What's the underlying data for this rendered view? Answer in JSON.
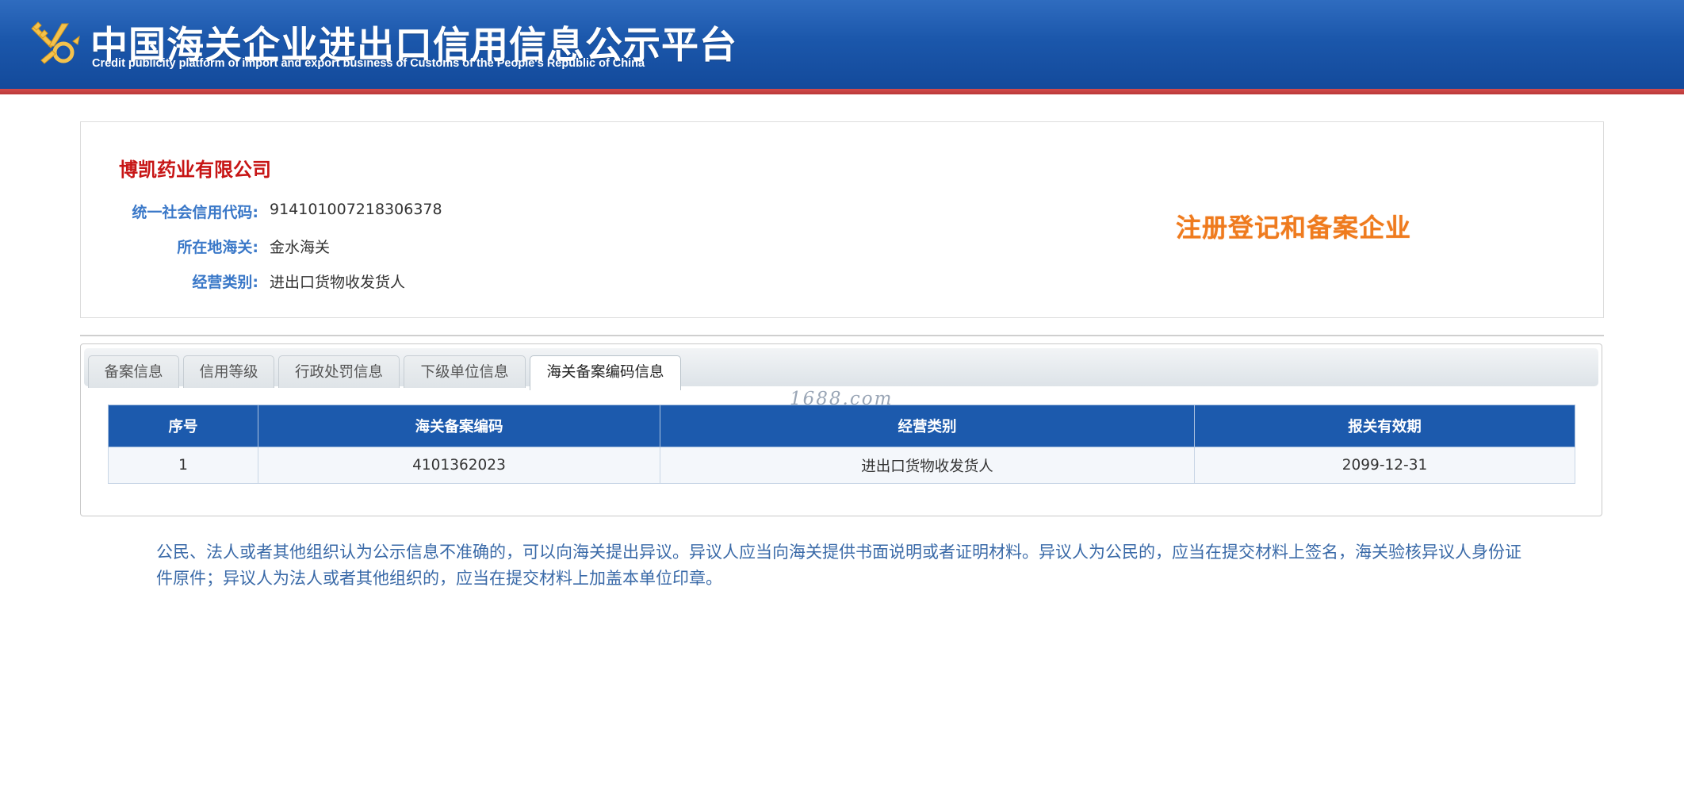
{
  "header": {
    "title": "中国海关企业进出口信用信息公示平台",
    "subtitle": "Credit publicity platform of import and export business of Customs of the People's Republic of China"
  },
  "company": {
    "name": "博凯药业有限公司",
    "fields": [
      {
        "label": "统一社会信用代码:",
        "value": "914101007218306378"
      },
      {
        "label": "所在地海关:",
        "value": "金水海关"
      },
      {
        "label": "经营类别:",
        "value": "进出口货物收发货人"
      }
    ],
    "status_stamp": "注册登记和备案企业"
  },
  "tabs": [
    {
      "label": "备案信息",
      "active": false
    },
    {
      "label": "信用等级",
      "active": false
    },
    {
      "label": "行政处罚信息",
      "active": false
    },
    {
      "label": "下级单位信息",
      "active": false
    },
    {
      "label": "海关备案编码信息",
      "active": true
    }
  ],
  "watermark": "1688.com",
  "table": {
    "columns": [
      "序号",
      "海关备案编码",
      "经营类别",
      "报关有效期"
    ],
    "rows": [
      [
        "1",
        "4101362023",
        "进出口货物收发货人",
        "2099-12-31"
      ]
    ]
  },
  "notice": "公民、法人或者其他组织认为公示信息不准确的，可以向海关提出异议。异议人应当向海关提供书面说明或者证明材料。异议人为公民的，应当在提交材料上签名，海关验核异议人身份证件原件；异议人为法人或者其他组织的，应当在提交材料上加盖本单位印章。",
  "colors": {
    "header_blue": "#1b57ab",
    "header_red_line": "#b93838",
    "company_name_red": "#c71515",
    "label_blue": "#3a78c8",
    "stamp_orange": "#ef7b1e",
    "table_header_blue": "#1c5aad"
  }
}
